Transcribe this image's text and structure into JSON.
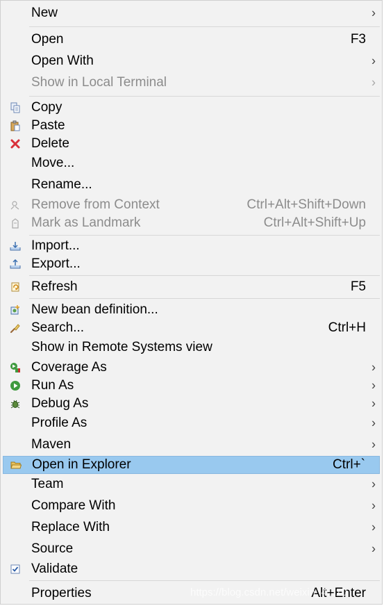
{
  "menu": {
    "new": {
      "label": "New",
      "arrow": "›"
    },
    "open": {
      "label": "Open",
      "shortcut": "F3"
    },
    "open_with": {
      "label": "Open With",
      "arrow": "›"
    },
    "show_local_terminal": {
      "label": "Show in Local Terminal",
      "arrow": "›"
    },
    "copy": {
      "label": "Copy",
      "icon": "copy-icon"
    },
    "paste": {
      "label": "Paste",
      "icon": "paste-icon"
    },
    "delete": {
      "label": "Delete",
      "icon": "delete-icon"
    },
    "move": {
      "label": "Move..."
    },
    "rename": {
      "label": "Rename..."
    },
    "remove_from_context": {
      "label": "Remove from Context",
      "shortcut": "Ctrl+Alt+Shift+Down",
      "icon": "remove-context-icon"
    },
    "mark_landmark": {
      "label": "Mark as Landmark",
      "shortcut": "Ctrl+Alt+Shift+Up",
      "icon": "landmark-icon"
    },
    "import": {
      "label": "Import...",
      "icon": "import-icon"
    },
    "export": {
      "label": "Export...",
      "icon": "export-icon"
    },
    "refresh": {
      "label": "Refresh",
      "shortcut": "F5",
      "icon": "refresh-icon"
    },
    "new_bean": {
      "label": "New bean definition...",
      "icon": "bean-icon"
    },
    "search": {
      "label": "Search...",
      "shortcut": "Ctrl+H",
      "icon": "search-icon"
    },
    "show_remote": {
      "label": "Show in Remote Systems view"
    },
    "coverage_as": {
      "label": "Coverage As",
      "arrow": "›",
      "icon": "coverage-icon"
    },
    "run_as": {
      "label": "Run As",
      "arrow": "›",
      "icon": "run-icon"
    },
    "debug_as": {
      "label": "Debug As",
      "arrow": "›",
      "icon": "debug-icon"
    },
    "profile_as": {
      "label": "Profile As",
      "arrow": "›"
    },
    "maven": {
      "label": "Maven",
      "arrow": "›"
    },
    "open_explorer": {
      "label": "Open in Explorer",
      "shortcut": "Ctrl+`",
      "icon": "folder-icon"
    },
    "team": {
      "label": "Team",
      "arrow": "›"
    },
    "compare_with": {
      "label": "Compare With",
      "arrow": "›"
    },
    "replace_with": {
      "label": "Replace With",
      "arrow": "›"
    },
    "source": {
      "label": "Source",
      "arrow": "›"
    },
    "validate": {
      "label": "Validate",
      "icon": "checkbox-icon"
    },
    "properties": {
      "label": "Properties",
      "shortcut": "Alt+Enter"
    }
  },
  "watermark": "https://blog.csdn.net/weixin_4...10",
  "colors": {
    "background": "#f2f2f2",
    "highlight": "#99c9ef",
    "disabled_text": "#8c8c8c"
  }
}
